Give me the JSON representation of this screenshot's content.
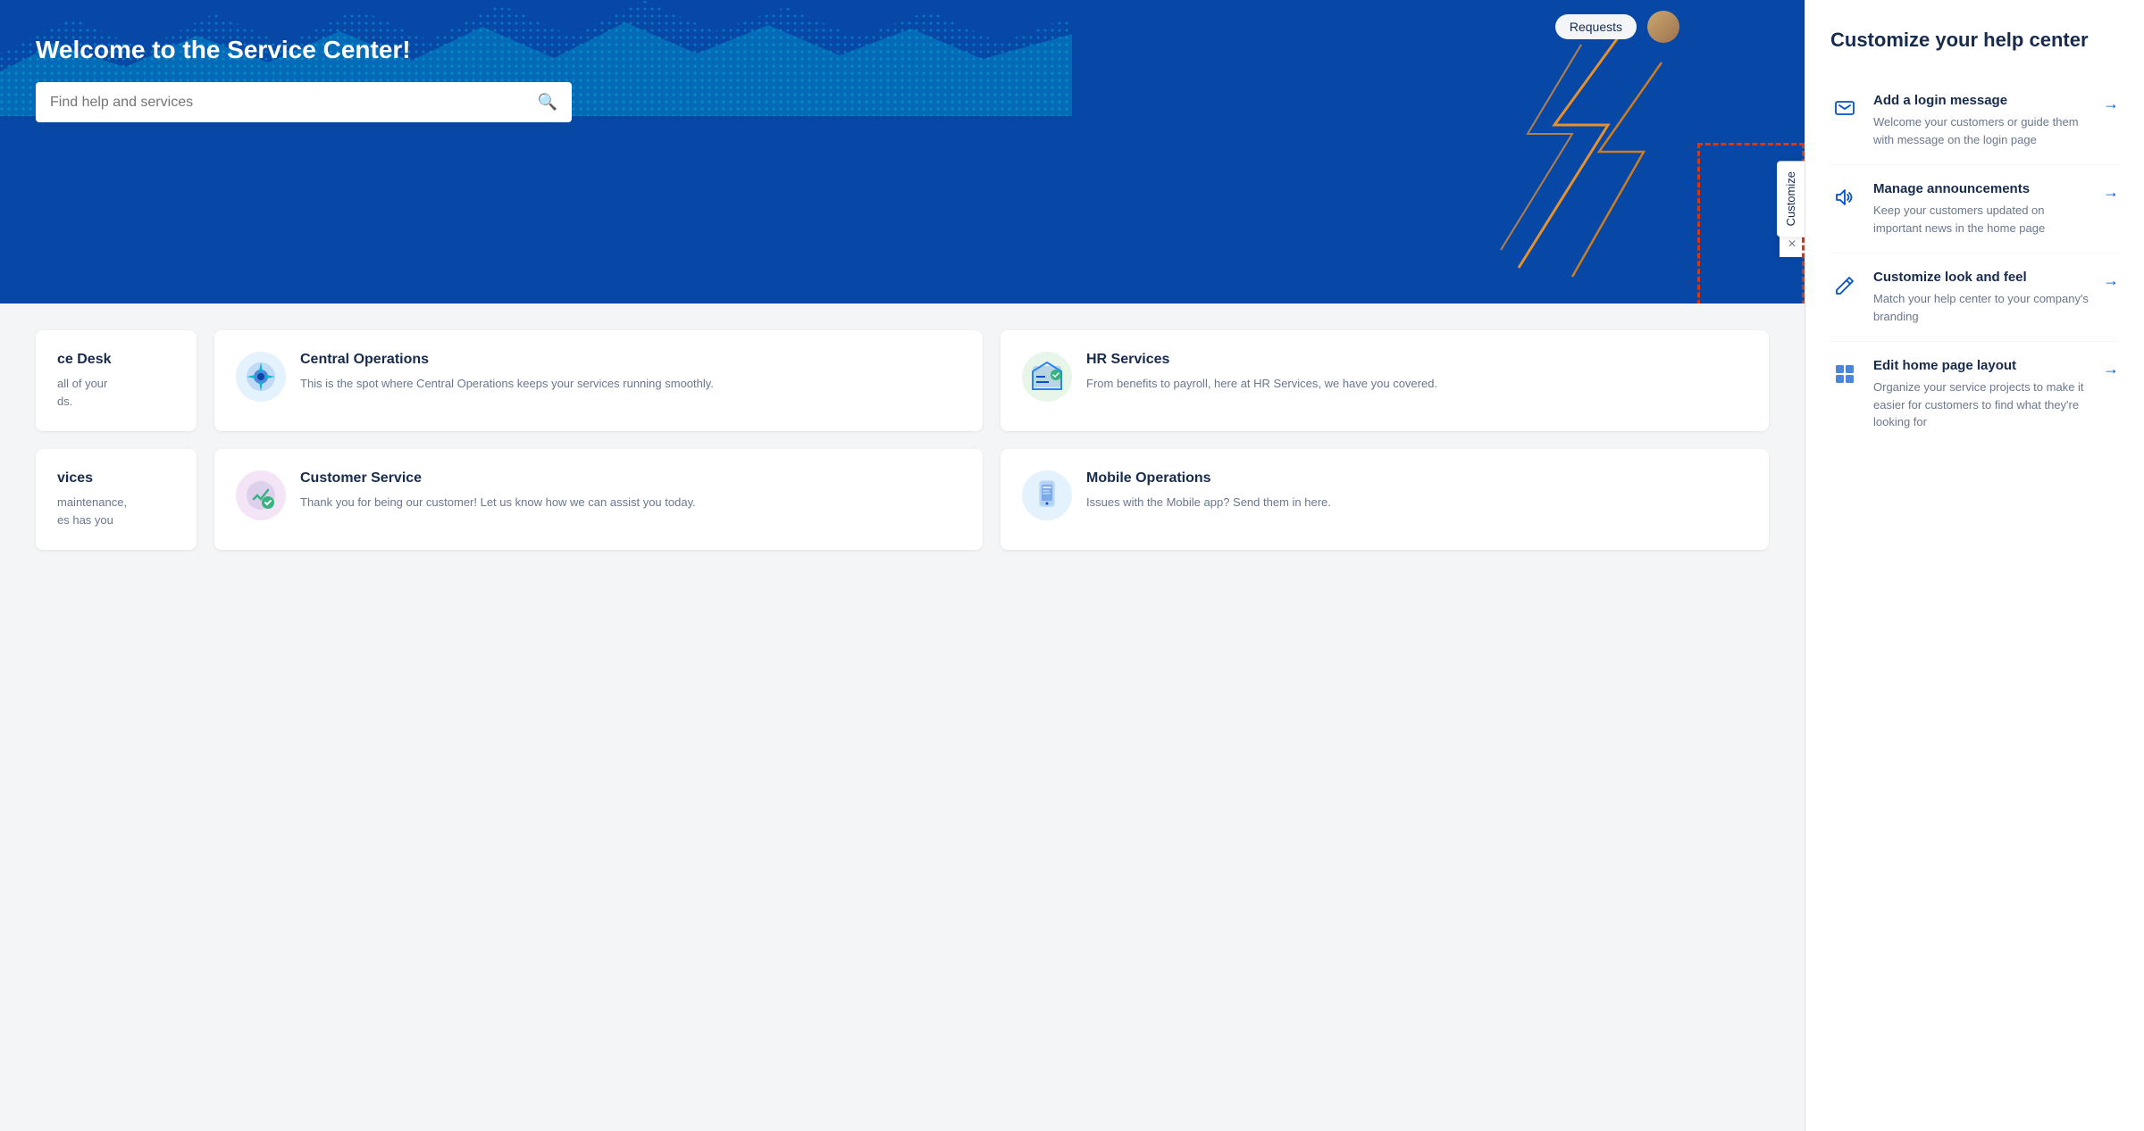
{
  "hero": {
    "title": "Welcome to the Service Center!",
    "search_placeholder": "Find help and services"
  },
  "nav": {
    "requests_label": "Requests"
  },
  "customize": {
    "button_label": "Customize",
    "close_label": "×"
  },
  "sidebar": {
    "title": "Customize your help center",
    "items": [
      {
        "id": "login-message",
        "title": "Add a login message",
        "desc": "Welcome your customers or guide them with message on the login page",
        "icon": "💬"
      },
      {
        "id": "announcements",
        "title": "Manage announcements",
        "desc": "Keep your customers updated on important news in the home page",
        "icon": "📌"
      },
      {
        "id": "look-feel",
        "title": "Customize look and feel",
        "desc": "Match your help center to your company's branding",
        "icon": "✏️"
      },
      {
        "id": "home-layout",
        "title": "Edit home page layout",
        "desc": "Organize your service projects to make it easier for customers to find what they're looking for",
        "icon": "⊞"
      }
    ]
  },
  "service_cards": [
    {
      "id": "it-service-desk",
      "title": "IT Service Desk",
      "desc": "all of your ds.",
      "icon": "🖥️",
      "partial": true
    },
    {
      "id": "central-operations",
      "title": "Central Operations",
      "desc": "This is the spot where Central Operations keeps your services running smoothly.",
      "icon": "⚙️",
      "color": "#e3f2fd"
    },
    {
      "id": "hr-services",
      "title": "HR Services",
      "desc": "From benefits to payroll, here at HR Services, we have you covered.",
      "icon": "👥",
      "color": "#e8f5e9"
    },
    {
      "id": "it-services",
      "title": "IT Services",
      "desc": "maintenance, es has you",
      "icon": "🔧",
      "partial": true
    },
    {
      "id": "customer-service",
      "title": "Customer Service",
      "desc": "Thank you for being our customer! Let us know how we can assist you today.",
      "icon": "✅",
      "color": "#f3e5f5"
    },
    {
      "id": "mobile-operations",
      "title": "Mobile Operations",
      "desc": "Issues with the Mobile app? Send them in here.",
      "icon": "📱",
      "color": "#e3f2fd"
    }
  ]
}
